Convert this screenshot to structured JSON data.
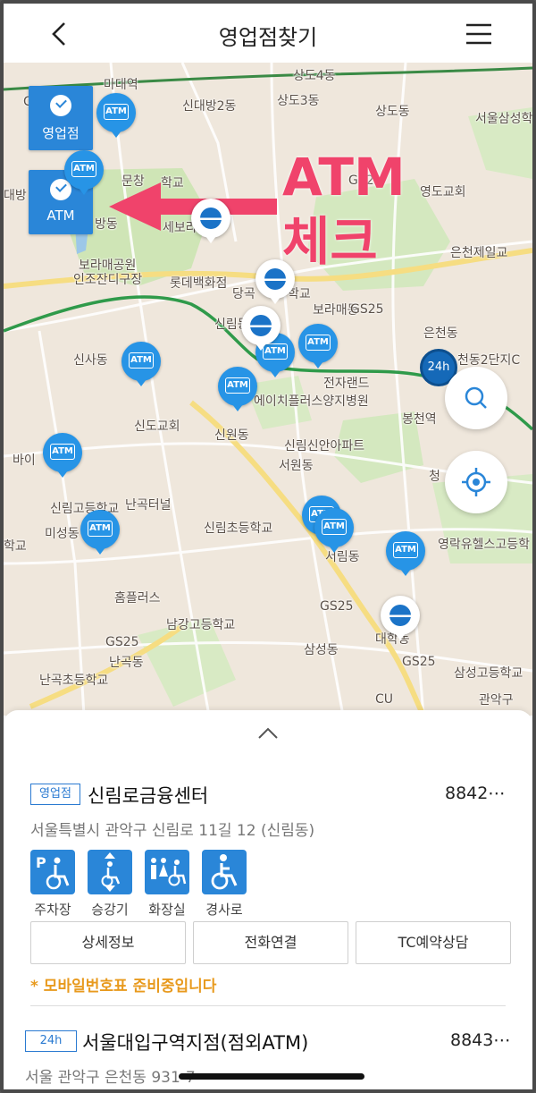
{
  "header": {
    "title": "영업점찾기"
  },
  "filters": {
    "branch_label": "영업점",
    "atm_label": "ATM"
  },
  "annotation": {
    "line1": "ATM",
    "line2": "체크"
  },
  "map_labels": [
    "상도4동",
    "신대방2동",
    "상도3동",
    "상도동",
    "서울삼성학",
    "문창",
    "학교",
    "GS2",
    "영도교회",
    "대방",
    "방동",
    "세보라",
    "은천제일교",
    "보라매공원",
    "인조잔디구장",
    "롯데백화점",
    "당곡",
    "학교",
    "보라매동",
    "GS25",
    "신림동",
    "은천동",
    "신사동",
    "전자랜드",
    "에이치플러스양지병원",
    "봉천역",
    "천동2단지C",
    "신도교회",
    "신원동",
    "신림신안아파트",
    "서원동",
    "바이",
    "신림고등학교",
    "난곡터널",
    "청",
    "미성동",
    "학교",
    "신림초등학교",
    "서림동",
    "영락유헬스고등학",
    "홈플러스",
    "GS25",
    "남강고등학교",
    "GS25",
    "난곡동",
    "삼성동",
    "대학동",
    "GS25",
    "난곡초등학교",
    "삼성고등학교",
    "CU",
    "관악구",
    "CU",
    "마대역"
  ],
  "pins": {
    "atm_text": "ATM",
    "h24_text": "24h"
  },
  "panel": {
    "branch1": {
      "badge": "영업점",
      "name": "신림로금융센터",
      "phone": "8842⋯",
      "address": "서울특별시 관악구 신림로 11길 12 (신림동)",
      "facilities": [
        "주차장",
        "승강기",
        "화장실",
        "경사로"
      ],
      "actions": [
        "상세정보",
        "전화연결",
        "TC예약상담"
      ],
      "notice": "* 모바일번호표 준비중입니다"
    },
    "branch2": {
      "badge": "24h",
      "name": "서울대입구역지점(점외ATM)",
      "phone": "8843⋯",
      "address": "서울 관악구 은천동 931-7"
    }
  },
  "colors": {
    "accent": "#2a86d8",
    "annotation": "#f0436b",
    "notice": "#e89a1e"
  }
}
